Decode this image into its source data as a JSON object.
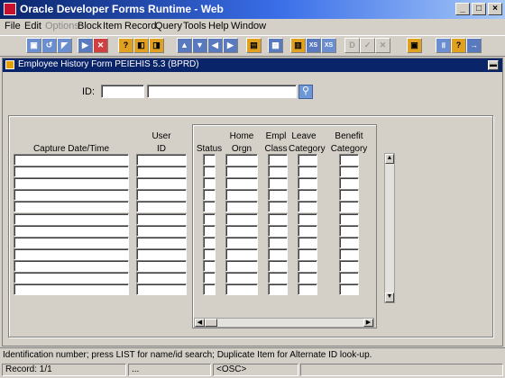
{
  "window": {
    "title": "Oracle Developer Forms Runtime - Web"
  },
  "menu": [
    "File",
    "Edit",
    "Options",
    "Block",
    "Item",
    "Record",
    "Query",
    "Tools",
    "Help",
    "Window"
  ],
  "menu_disabled": [
    "Options"
  ],
  "form": {
    "title": "Employee History Form  PEIEHIS  5.3  (BPRD)"
  },
  "key_block": {
    "id_label": "ID:",
    "id_value": "",
    "name_value": ""
  },
  "columns": {
    "capture_date": "Capture Date/Time",
    "user_id_1": "User",
    "user_id_2": "ID",
    "status": "Status",
    "home_orgn_1": "Home",
    "home_orgn_2": "Orgn",
    "empl_class_1": "Empl",
    "empl_class_2": "Class",
    "leave_cat_1": "Leave",
    "leave_cat_2": "Category",
    "benefit_cat_1": "Benefit",
    "benefit_cat_2": "Category"
  },
  "row_count": 12,
  "hint": {
    "text": "Identification number; press LIST for name/id search; Duplicate Item for Alternate ID look-up."
  },
  "status": {
    "record": "Record: 1/1",
    "dots": "...",
    "mode": "<OSC>"
  },
  "icons": {
    "search": "search-icon",
    "app": "oracle-forms-icon"
  }
}
